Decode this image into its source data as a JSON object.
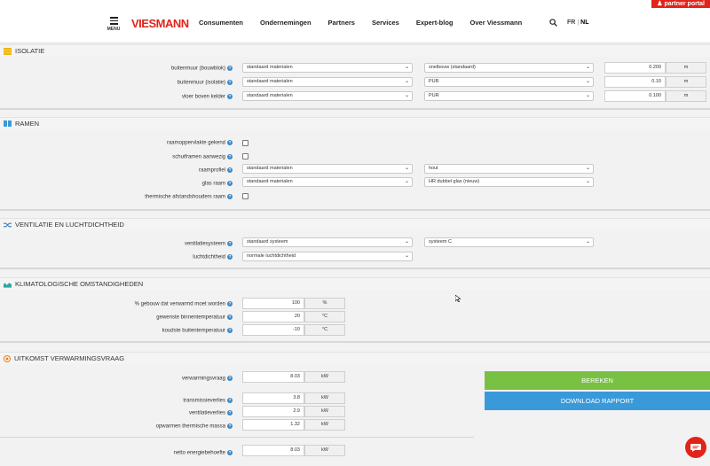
{
  "header": {
    "partner_portal": "partner portal",
    "menu_label": "MENU",
    "logo": "VIESMANN",
    "nav": [
      "Consumenten",
      "Ondernemingen",
      "Partners",
      "Services",
      "Expert-blog",
      "Over Viessmann"
    ],
    "lang_fr": "FR",
    "lang_nl": "NL"
  },
  "isolatie": {
    "title": "ISOLATIE",
    "rows": [
      {
        "label": "buitenmuur (bouwblok)",
        "sel1": "standaard materialen",
        "sel2": "snelbouw (standaard)",
        "value": "0.200",
        "unit": "m"
      },
      {
        "label": "buitenmuur (isolatie)",
        "sel1": "standaard materialen",
        "sel2": "PUR",
        "value": "0.10",
        "unit": "m"
      },
      {
        "label": "vloer boven kelder",
        "sel1": "standaard materialen",
        "sel2": "PUR",
        "value": "0.100",
        "unit": "m"
      }
    ]
  },
  "ramen": {
    "title": "RAMEN",
    "check1": "raamoppervlakte gekend",
    "check2": "schuiframen aanwezig",
    "raamprofiel": {
      "label": "raamprofiel",
      "sel1": "standaard materialen",
      "sel2": "hout"
    },
    "glas": {
      "label": "glas raam",
      "sel1": "standaard materialen",
      "sel2": "HR dubbel glas (nieuw)"
    },
    "check3": "thermische afstandshouders raam"
  },
  "ventilatie": {
    "title": "VENTILATIE EN LUCHTDICHTHEID",
    "systeem": {
      "label": "ventilatiesysteem",
      "sel1": "standaard systeem",
      "sel2": "systeem C"
    },
    "luchtdichtheid": {
      "label": "luchtdichtheid",
      "sel1": "normale luchtdichtheid"
    }
  },
  "klimaat": {
    "title": "KLIMATOLOGISCHE OMSTANDIGHEDEN",
    "rows": [
      {
        "label": "% gebouw dat verwarmd moet worden",
        "value": "100",
        "unit": "%"
      },
      {
        "label": "gewenste binnentemperatuur",
        "value": "20",
        "unit": "°C"
      },
      {
        "label": "koudste buitentemperatuur",
        "value": "-10",
        "unit": "°C"
      }
    ]
  },
  "uitkomst": {
    "title": "UITKOMST VERWARMINGSVRAAG",
    "verwarmingsvraag": {
      "label": "verwarmingsvraag",
      "value": "8.03",
      "unit": "kW"
    },
    "transmissie": {
      "label": "transmissieverlies",
      "value": "3.8",
      "unit": "kW"
    },
    "ventilatie": {
      "label": "ventilatieverlies",
      "value": "2.9",
      "unit": "kW"
    },
    "massa": {
      "label": "opwarmen thermische massa",
      "value": "1.32",
      "unit": "kW"
    },
    "netto": {
      "label": "netto energiebehoefte",
      "value": "8.03",
      "unit": "kW"
    },
    "bereken": "BEREKEN",
    "download": "DOWNLOAD RAPPORT"
  },
  "colors": {
    "brand": "#e2231a",
    "green": "#79c143",
    "blue": "#3a9ad9"
  }
}
